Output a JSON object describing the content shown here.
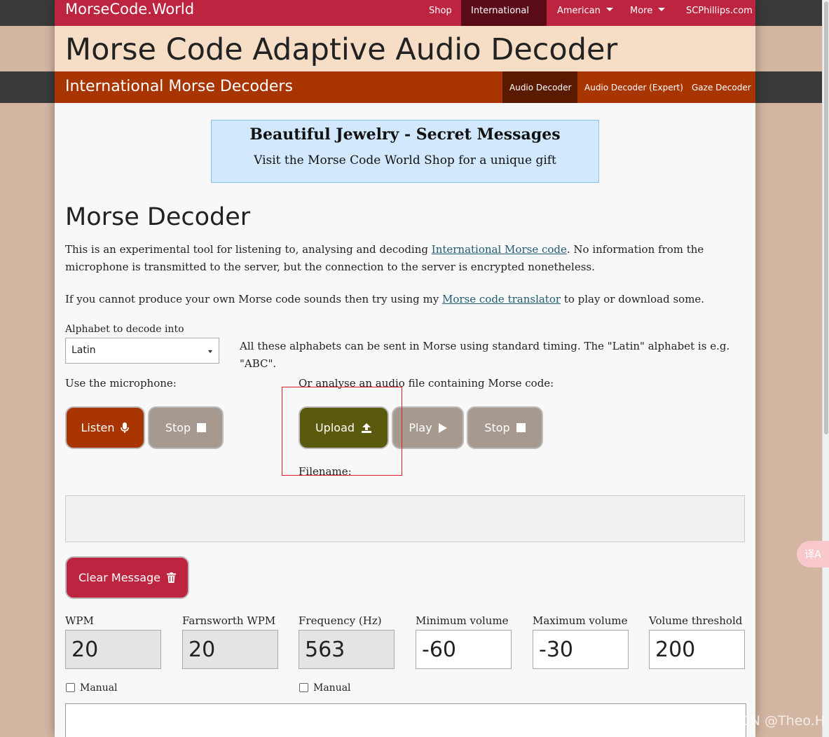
{
  "nav": {
    "brand": "MorseCode.World",
    "items": [
      {
        "label": "Shop"
      },
      {
        "label": "International"
      },
      {
        "label": "American"
      },
      {
        "label": "More"
      },
      {
        "label": "SCPhillips.com"
      }
    ]
  },
  "header": {
    "title": "Morse Code Adaptive Audio Decoder"
  },
  "subnav": {
    "section": "International Morse Decoders",
    "items": [
      {
        "label": "Audio Decoder"
      },
      {
        "label": "Audio Decoder (Expert)"
      },
      {
        "label": "Gaze Decoder"
      }
    ]
  },
  "ad": {
    "title": "Beautiful Jewelry - Secret Messages",
    "text": "Visit the Morse Code World Shop for a unique gift"
  },
  "main": {
    "heading": "Morse Decoder",
    "intro_1a": "This is an experimental tool for listening to, analysing and decoding ",
    "intro_1_link": "International Morse code",
    "intro_1b": ". No information from the microphone is transmitted to the server, but the connection to the server is encrypted nonetheless.",
    "intro_2a": "If you cannot produce your own Morse code sounds then try using my ",
    "intro_2_link": "Morse code translator",
    "intro_2b": " to play or download some.",
    "alphabet_label": "Alphabet to decode into",
    "alphabet_value": "Latin",
    "alphabet_note": "All these alphabets can be sent in Morse using standard timing. The \"Latin\" alphabet is e.g. \"ABC\".",
    "mic_label": "Use the microphone:",
    "file_label": "Or analyse an audio file containing Morse code:",
    "filename_label": "Filename:",
    "buttons": {
      "listen": "Listen",
      "stop_mic": "Stop",
      "upload": "Upload",
      "play": "Play",
      "stop_file": "Stop",
      "clear": "Clear Message"
    }
  },
  "settings": {
    "fields": [
      {
        "label": "WPM",
        "value": "20"
      },
      {
        "label": "Farnsworth WPM",
        "value": "20"
      },
      {
        "label": "Frequency (Hz)",
        "value": "563"
      },
      {
        "label": "Minimum volume",
        "value": "-60"
      },
      {
        "label": "Maximum volume",
        "value": "-30"
      },
      {
        "label": "Volume threshold",
        "value": "200"
      }
    ],
    "manual_label_1": "Manual",
    "manual_label_2": "Manual"
  },
  "overlay": {
    "translate_glyph": "译A",
    "watermark": "CSDN @Theo.H"
  },
  "colors": {
    "nav_red": "#bd2440",
    "sub_brown": "#a83400",
    "upload_olive": "#5a5a0e",
    "button_grey": "#a69990",
    "header_peach": "#f6dec6",
    "ad_blue": "#d2e8fd"
  }
}
